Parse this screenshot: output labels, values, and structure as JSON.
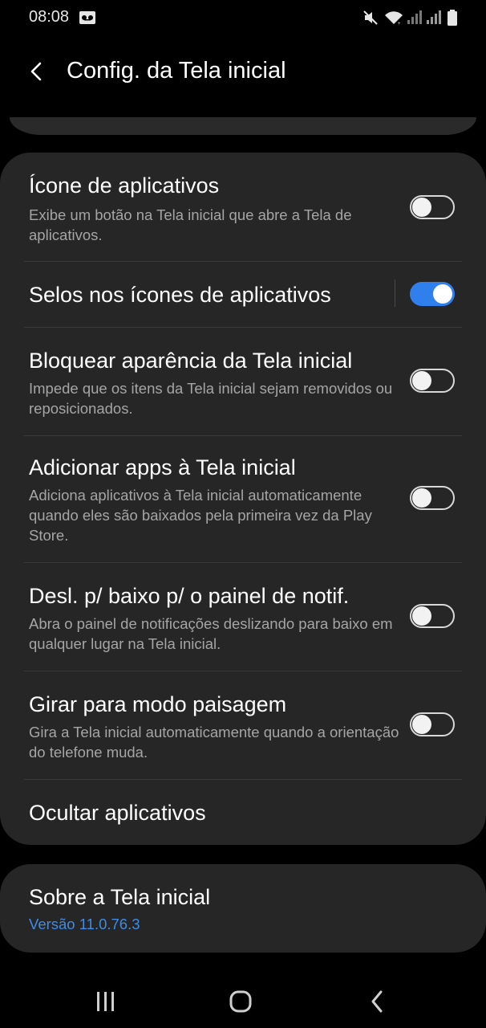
{
  "status": {
    "time": "08:08"
  },
  "header": {
    "title": "Config. da Tela inicial"
  },
  "settings": [
    {
      "title": "Ícone de aplicativos",
      "desc": "Exibe um botão na Tela inicial que abre a Tela de aplicativos.",
      "toggle": "off"
    },
    {
      "title": "Selos nos ícones de aplicativos",
      "desc": "",
      "toggle": "on"
    },
    {
      "title": "Bloquear aparência da Tela inicial",
      "desc": "Impede que os itens da Tela inicial sejam removidos ou reposicionados.",
      "toggle": "off"
    },
    {
      "title": "Adicionar apps à Tela inicial",
      "desc": "Adiciona aplicativos à Tela inicial automaticamente quando eles são baixados pela primeira vez da Play Store.",
      "toggle": "off"
    },
    {
      "title": "Desl. p/ baixo p/ o painel de notif.",
      "desc": "Abra o painel de notificações deslizando para baixo em qualquer lugar na Tela inicial.",
      "toggle": "off"
    },
    {
      "title": "Girar para modo paisagem",
      "desc": "Gira a Tela inicial automaticamente quando a orientação do telefone muda.",
      "toggle": "off"
    },
    {
      "title": "Ocultar aplicativos"
    }
  ],
  "about": {
    "title": "Sobre a Tela inicial",
    "version": "Versão 11.0.76.3"
  },
  "colors": {
    "accent": "#2f80ed",
    "link": "#3d8ce6",
    "card": "#262626",
    "background": "#000000"
  },
  "icons": [
    "voicemail-icon",
    "mute-icon",
    "wifi-icon",
    "signal-icon",
    "battery-icon",
    "back-arrow-icon",
    "recent-apps-icon",
    "home-icon",
    "nav-back-icon"
  ]
}
